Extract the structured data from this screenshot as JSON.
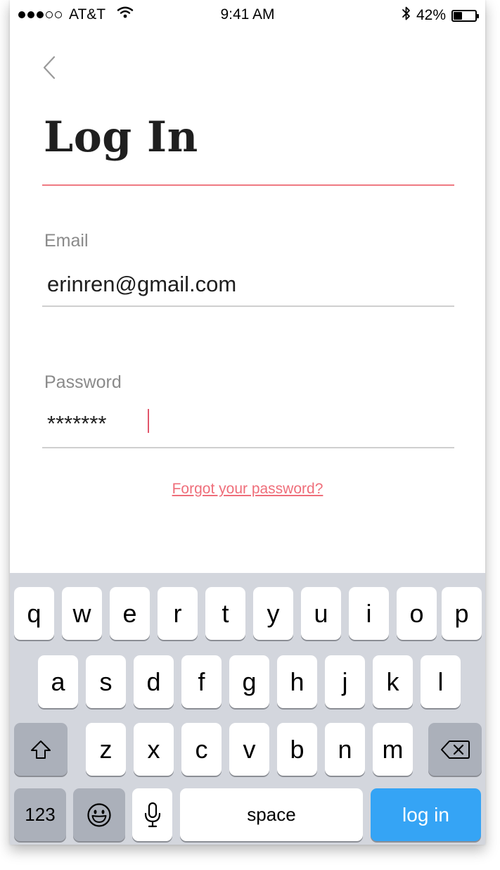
{
  "status_bar": {
    "carrier": "AT&T",
    "time": "9:41 AM",
    "battery": "42%",
    "battery_level": 0.42,
    "signal_bars_filled": 3,
    "signal_bars_total": 5,
    "icons": [
      "signal-icon",
      "wifi-icon",
      "bluetooth-icon",
      "battery-icon"
    ]
  },
  "nav": {
    "back_icon": "chevron-left-icon"
  },
  "title": "Log In",
  "email": {
    "label": "Email",
    "value": "erinren@gmail.com"
  },
  "password": {
    "label": "Password",
    "value": "*******"
  },
  "forgot_link": "Forgot your password?",
  "colors": {
    "accent": "#ef7a82",
    "link": "#ef6e7a",
    "caret": "#e2566b",
    "action_key": "#35a4f5",
    "keyboard_bg": "#d3d6dd",
    "dark_key": "#abb0ba"
  },
  "keyboard": {
    "row1": [
      "q",
      "w",
      "e",
      "r",
      "t",
      "y",
      "u",
      "i",
      "o",
      "p"
    ],
    "row2": [
      "a",
      "s",
      "d",
      "f",
      "g",
      "h",
      "j",
      "k",
      "l"
    ],
    "row3": [
      "z",
      "x",
      "c",
      "v",
      "b",
      "n",
      "m"
    ],
    "numbers_key": "123",
    "space_key": "space",
    "action_key": "log in",
    "shift_icon": "shift-icon",
    "delete_icon": "delete-icon",
    "emoji_icon": "emoji-icon",
    "mic_icon": "microphone-icon"
  }
}
